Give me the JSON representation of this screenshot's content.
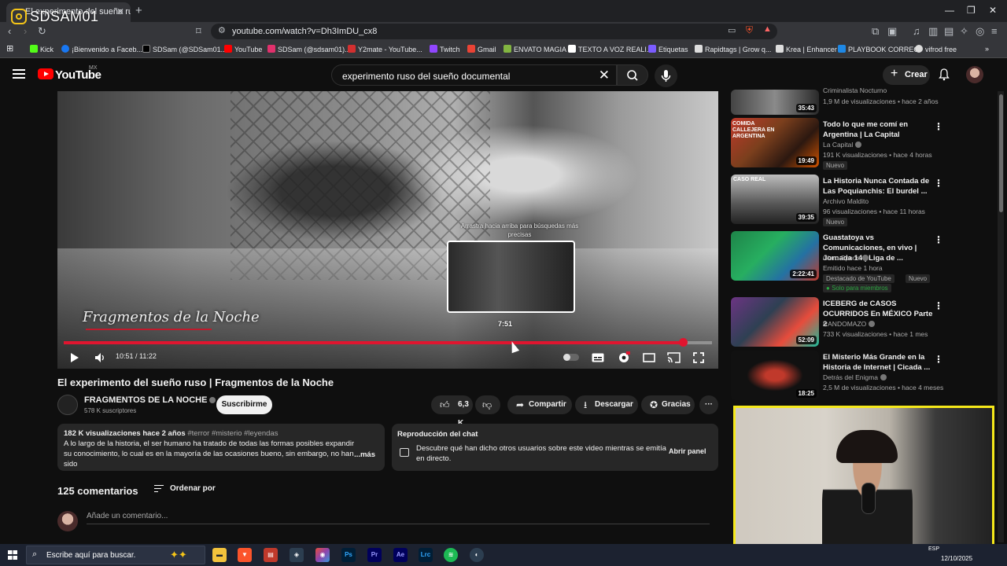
{
  "browser": {
    "tab_title": "El experimento del sueño ruso |",
    "url": "youtube.com/watch?v=Dh3ImDU_cx8",
    "bookmarks": [
      {
        "label": "Kick",
        "color": "#53fc18"
      },
      {
        "label": "¡Bienvenido a Faceb...",
        "color": "#1877f2"
      },
      {
        "label": "SDSam (@SDSam01...",
        "color": "#000000"
      },
      {
        "label": "YouTube",
        "color": "#ff0000"
      },
      {
        "label": "SDSam (@sdsam01)...",
        "color": "#e1306c"
      },
      {
        "label": "Y2mate - YouTube...",
        "color": "#d32f2f"
      },
      {
        "label": "Twitch",
        "color": "#9146ff"
      },
      {
        "label": "Gmail",
        "color": "#ea4335"
      },
      {
        "label": "ENVATO MAGIA",
        "color": "#82b541"
      },
      {
        "label": "TEXTO A VOZ REALI...",
        "color": "#ffffff"
      },
      {
        "label": "Etiquetas",
        "color": "#7b5cff"
      },
      {
        "label": "Rapidtags | Grow q...",
        "color": "#ffffff"
      },
      {
        "label": "Krea | Enhancer",
        "color": "#ffffff"
      },
      {
        "label": "PLAYBOOK CORREO",
        "color": "#1e88e5"
      },
      {
        "label": "vifrod free",
        "color": "#ffffff"
      }
    ]
  },
  "watermark": {
    "text": "SDSAM01"
  },
  "youtube": {
    "logo_text": "YouTube",
    "country": "MX",
    "search_query": "experimento ruso del sueño documental",
    "create_label": "Crear"
  },
  "player": {
    "overlay_title": "Fragmentos de la Noche",
    "hint_text": "Arrastra hacia arriba para búsquedas más precisas",
    "preview_time": "7:51",
    "time_current": "10:51",
    "time_total": "11:22",
    "time_readout": "10:51 / 11:22",
    "progress_fraction": 0.955,
    "hover_fraction": 0.69
  },
  "video": {
    "title": "El experimento del sueño ruso | Fragmentos de la Noche",
    "channel": "FRAGMENTOS DE LA NOCHE",
    "subscribers": "578 K suscriptores",
    "subscribe_label": "Suscribirme",
    "likes": "6,3 K",
    "share_label": "Compartir",
    "download_label": "Descargar",
    "thanks_label": "Gracias",
    "description_meta": "182 K visualizaciones  hace 2 años",
    "description_tags": "#terror #misterio #leyendas",
    "description_text": "A lo largo de la historia, el ser humano ha tratado de todas las formas posibles expandir su conocimiento, lo cual es en la mayoría de las ocasiones bueno, sin embargo, no han sido",
    "more_label": "...más",
    "chat_title": "Reproducción del chat",
    "chat_desc": "Descubre qué han dicho otros usuarios sobre este video mientras se emitía en directo.",
    "chat_open": "Abrir panel",
    "comments_count": "125 comentarios",
    "sort_label": "Ordenar por",
    "comment_placeholder": "Añade un comentario..."
  },
  "sidebar": {
    "items": [
      {
        "title": "",
        "channel": "Criminalista Nocturno",
        "meta": "1,9 M de visualizaciones • hace 2 años",
        "duration": "35:43",
        "badge": ""
      },
      {
        "title": "Todo lo que me comí en Argentina | La Capital",
        "channel": "La Capital",
        "meta": "191 K visualizaciones • hace 4 horas",
        "duration": "19:49",
        "badge": "Nuevo",
        "thumb_text": "COMIDA CALLEJERA EN ARGENTINA"
      },
      {
        "title": "La Historia Nunca Contada de Las Poquianchis: El burdel ...",
        "channel": "Archivo Maldito",
        "meta": "96 visualizaciones • hace 11 horas",
        "duration": "39:35",
        "badge": "Nuevo",
        "thumb_text": "CASO REAL"
      },
      {
        "title": "Guastatoya vs Comunicaciones, en vivo | Jornada 14 | Liga de ...",
        "channel": "Claro Sports",
        "meta": "Emitido hace 1 hora",
        "duration": "2:22:41",
        "badge": "Destacado de YouTube",
        "badge2": "Nuevo",
        "badge3": "Solo para miembros"
      },
      {
        "title": "ICEBERG de CASOS OCURRIDOS En MÉXICO Parte 2",
        "channel": "RANDOMAZO",
        "meta": "733 K visualizaciones • hace 1 mes",
        "duration": "52:09",
        "badge": ""
      },
      {
        "title": "El Misterio Más Grande en la Historia de Internet | Cicada ...",
        "channel": "Detrás del Enigma",
        "meta": "2,5 M de visualizaciones • hace 4 meses",
        "duration": "18:25",
        "badge": ""
      }
    ]
  },
  "taskbar": {
    "search_placeholder": "Escribe aquí para buscar.",
    "lang": "ESP",
    "date": "12/10/2025"
  }
}
